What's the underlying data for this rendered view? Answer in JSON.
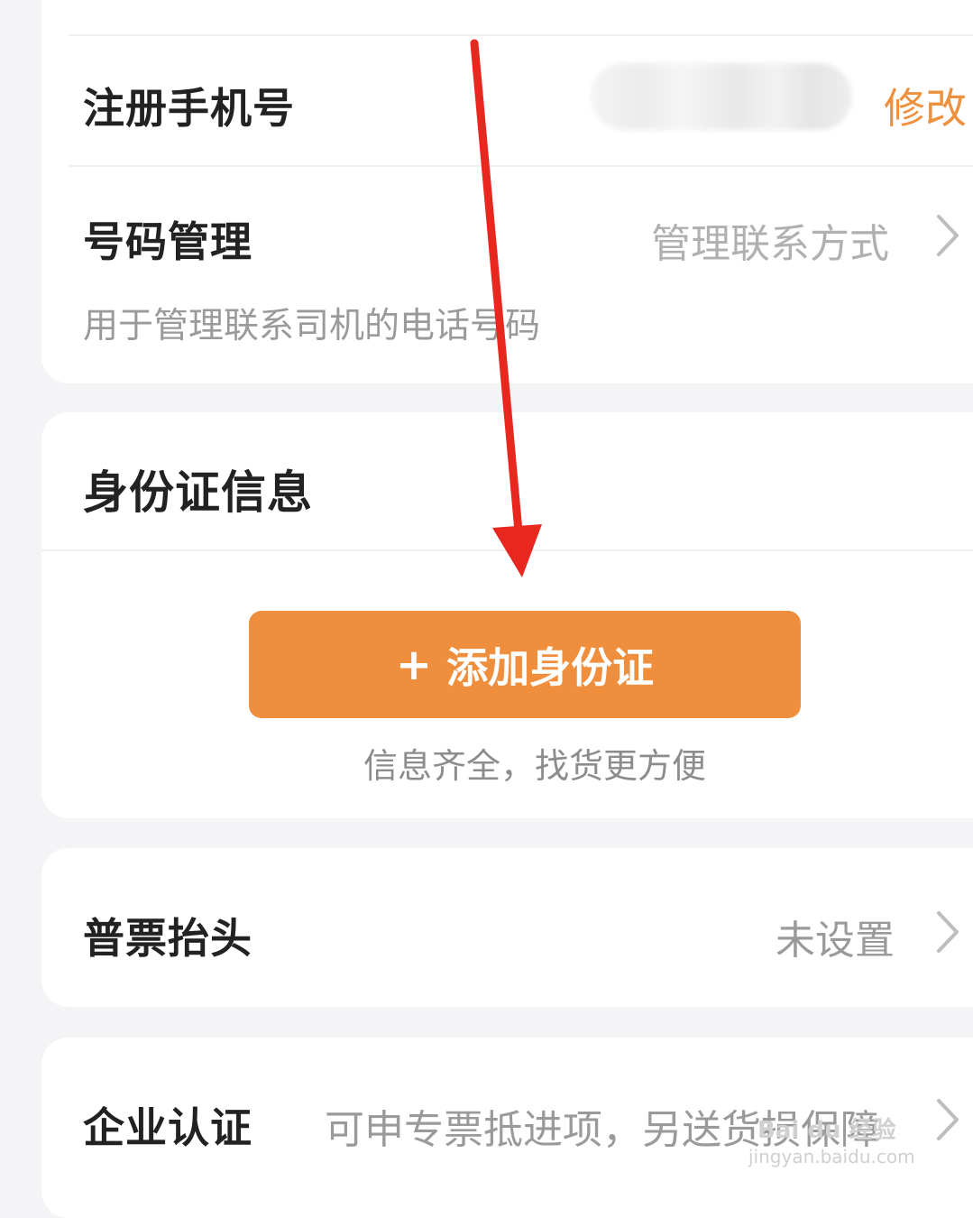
{
  "phone_row": {
    "title": "注册手机号",
    "action": "修改"
  },
  "number_manage": {
    "title": "号码管理",
    "value": "管理联系方式",
    "description": "用于管理联系司机的电话号码"
  },
  "id_card": {
    "title": "身份证信息",
    "button_plus": "+",
    "button_label": "添加身份证",
    "hint": "信息齐全，找货更方便"
  },
  "invoice": {
    "title": "普票抬头",
    "value": "未设置"
  },
  "enterprise": {
    "title": "企业认证",
    "value": "可申专票抵进项，另送货损保障"
  },
  "watermark": {
    "text": "Bai du 经验",
    "url": "jingyan.baidu.com"
  },
  "colors": {
    "accent": "#ef8f3e",
    "annotation_arrow": "#e8281e"
  }
}
